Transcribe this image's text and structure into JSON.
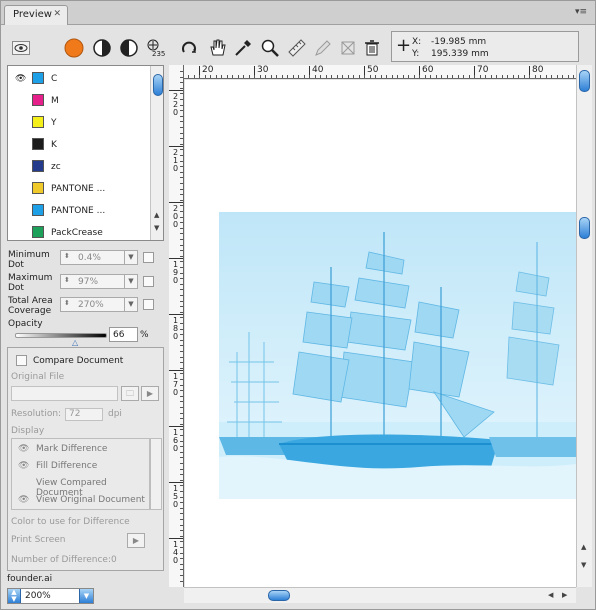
{
  "tab": {
    "title": "Preview",
    "close": "✕"
  },
  "panel_menu": "▾≡",
  "toolbar": {
    "tools": [
      "toggle-view-icon",
      "overprint-icon",
      "separation-icon",
      "channel-icon",
      "density-icon",
      "hand-refresh-icon",
      "hand-icon",
      "eyedropper-icon",
      "zoom-icon",
      "ruler-icon",
      "pencil-icon",
      "crop-icon",
      "trash-icon"
    ],
    "density_caption": "235"
  },
  "coords": {
    "x_label": "X:",
    "x_value": "-19.985 mm",
    "y_label": "Y:",
    "y_value": "195.339 mm"
  },
  "separations": [
    {
      "name": "C",
      "color": "#1ea0e6",
      "visible": true
    },
    {
      "name": "M",
      "color": "#e5208b",
      "visible": false
    },
    {
      "name": "Y",
      "color": "#f6f01a",
      "visible": false
    },
    {
      "name": "K",
      "color": "#1b1b1b",
      "visible": false
    },
    {
      "name": "zc",
      "color": "#243a8a",
      "visible": false
    },
    {
      "name": "PANTONE ...",
      "color": "#f0c92a",
      "visible": false
    },
    {
      "name": "PANTONE ...",
      "color": "#1ea0e6",
      "visible": false
    },
    {
      "name": "PackCrease",
      "color": "#1da05a",
      "visible": false
    }
  ],
  "dot_settings": {
    "min_dot_label_1": "Minimum",
    "min_dot_label_2": "Dot",
    "min_dot_value": "0.4%",
    "max_dot_label_1": "Maximum",
    "max_dot_label_2": "Dot",
    "max_dot_value": "97%",
    "tac_label_1": "Total Area",
    "tac_label_2": "Coverage",
    "tac_value": "270%"
  },
  "opacity": {
    "label": "Opacity",
    "value": "66",
    "unit": "%",
    "level": 0.66
  },
  "compare": {
    "compare_label": "Compare Document",
    "original_file_label": "Original File",
    "resolution_label": "Resolution:",
    "resolution_value": "72",
    "resolution_unit": "dpi",
    "display_label": "Display",
    "display_items": [
      "Mark Difference",
      "Fill Difference",
      "View Compared Document",
      "View Original Document"
    ],
    "color_diff_label": "Color to use for Difference",
    "print_screen_label": "Print Screen",
    "num_diff_label": "Number of Difference:0"
  },
  "filename": "founder.ai",
  "zoom": "200%",
  "ruler": {
    "h_labels": [
      "20",
      "30",
      "40",
      "50",
      "60",
      "70",
      "80"
    ],
    "v_labels": [
      "220",
      "210",
      "200",
      "190",
      "180",
      "170",
      "160",
      "150",
      "140"
    ]
  },
  "colors": {
    "cyan": "#5fc3ef",
    "accent_blue": "#2d7fd6"
  }
}
